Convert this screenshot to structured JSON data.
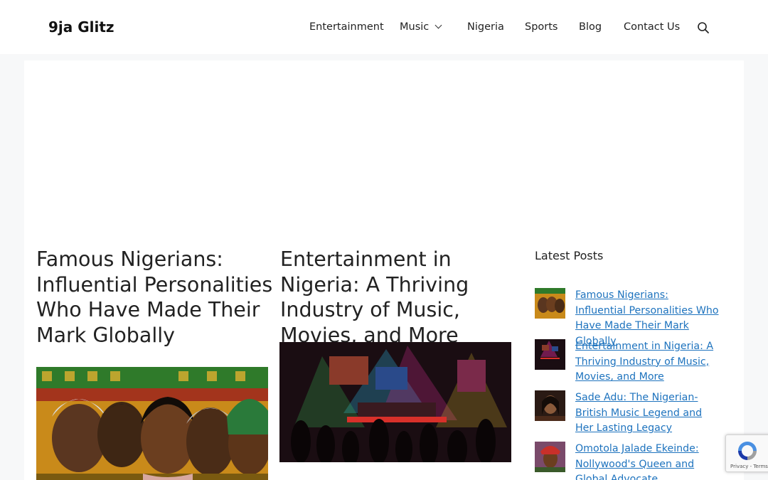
{
  "site": {
    "logo": "9ja Glitz"
  },
  "nav": {
    "items": [
      {
        "label": "Entertainment"
      },
      {
        "label": "Music"
      },
      {
        "label": "Nigeria"
      },
      {
        "label": "Sports"
      },
      {
        "label": "Blog"
      },
      {
        "label": "Contact Us"
      }
    ],
    "search_icon": "search-icon"
  },
  "posts": [
    {
      "title": "Famous Nigerians: Influential Personalities Who Have Made Their Mark Globally"
    },
    {
      "title": "Entertainment in Nigeria: A Thriving Industry of Music, Movies, and More"
    }
  ],
  "sidebar": {
    "heading": "Latest Posts",
    "items": [
      {
        "label": "Famous Nigerians: Influential Personalities Who Have Made Their Mark Globally"
      },
      {
        "label": "Entertainment in Nigeria: A Thriving Industry of Music, Movies, and More"
      },
      {
        "label": "Sade Adu: The Nigerian-British Music Legend and Her Lasting Legacy"
      },
      {
        "label": "Omotola Jalade Ekeinde: Nollywood's Queen and Global Advocate"
      }
    ]
  },
  "recaptcha": {
    "terms": "Privacy - Terms"
  },
  "colors": {
    "link": "#1e73be",
    "background": "#f7f8f9",
    "header": "#ffffff"
  }
}
